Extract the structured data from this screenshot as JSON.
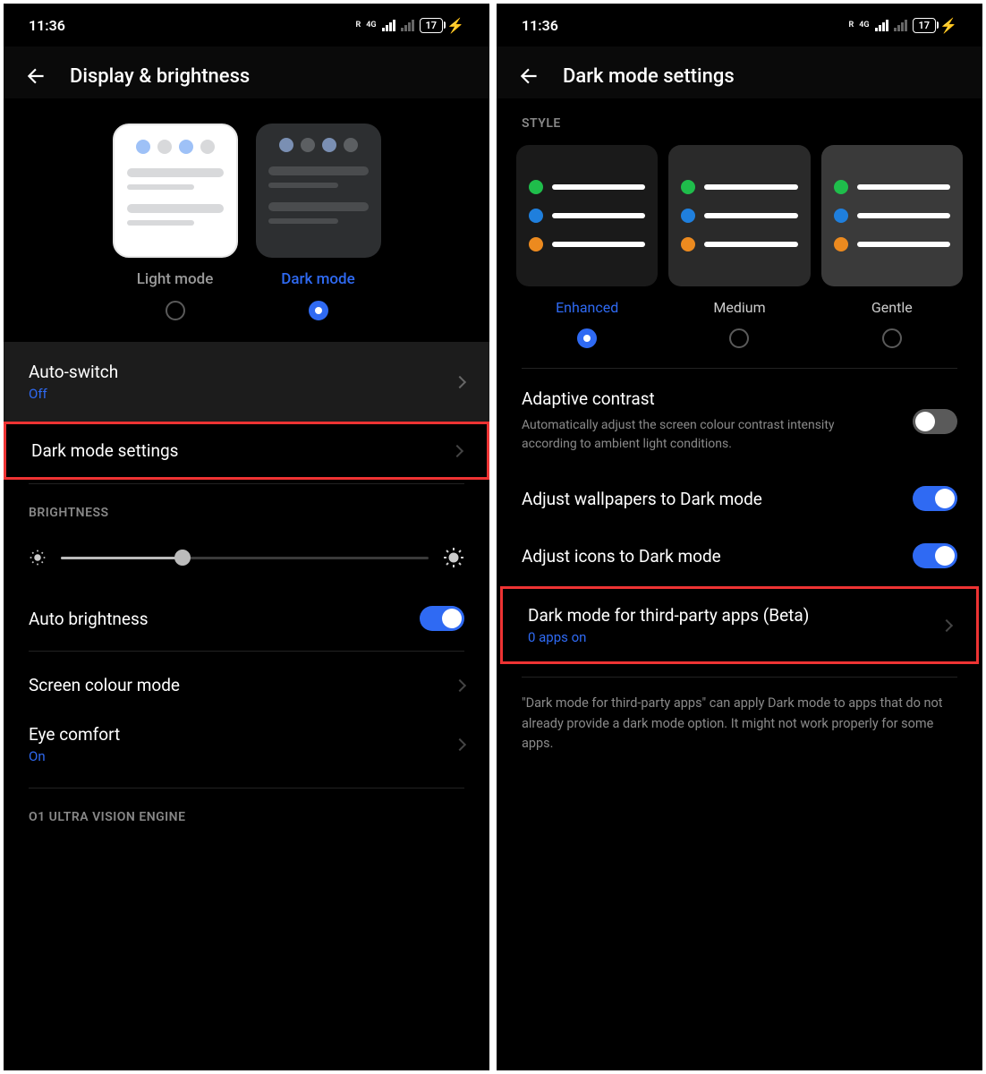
{
  "status": {
    "time": "11:36",
    "net_label": "4G",
    "net_sub": "R",
    "battery": "17"
  },
  "left": {
    "title": "Display & brightness",
    "modes": {
      "light": "Light mode",
      "dark": "Dark mode"
    },
    "auto_switch": {
      "title": "Auto-switch",
      "value": "Off"
    },
    "dark_settings": {
      "title": "Dark mode settings"
    },
    "brightness_header": "BRIGHTNESS",
    "auto_brightness": "Auto brightness",
    "screen_colour": "Screen colour mode",
    "eye_comfort": {
      "title": "Eye comfort",
      "value": "On"
    },
    "engine_header": "O1 ULTRA VISION ENGINE"
  },
  "right": {
    "title": "Dark mode settings",
    "style_header": "STYLE",
    "styles": {
      "enhanced": "Enhanced",
      "medium": "Medium",
      "gentle": "Gentle"
    },
    "adaptive": {
      "title": "Adaptive contrast",
      "desc": "Automatically adjust the screen colour contrast intensity according to ambient light conditions."
    },
    "adjust_wallpapers": "Adjust wallpapers to Dark mode",
    "adjust_icons": "Adjust icons to Dark mode",
    "third_party": {
      "title": "Dark mode for third-party apps (Beta)",
      "value": "0 apps on"
    },
    "footer": "\"Dark mode for third-party apps\" can apply Dark mode to apps that do not already provide a dark mode option. It might not work properly for some apps."
  }
}
